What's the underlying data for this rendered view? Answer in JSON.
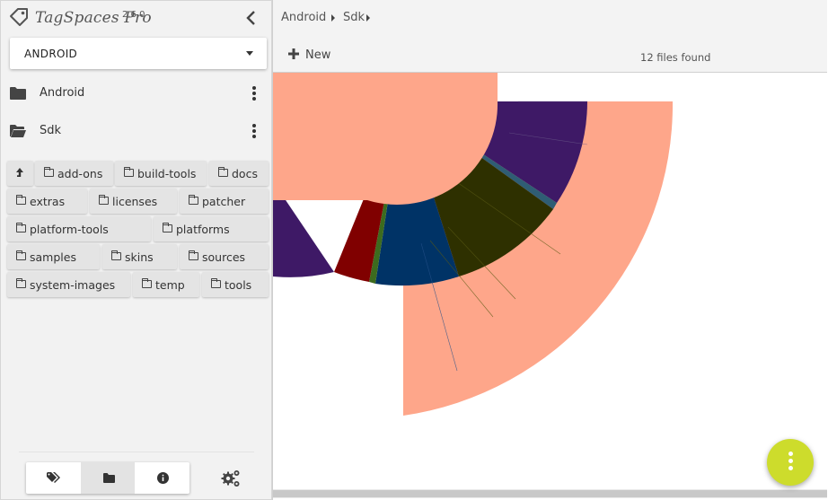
{
  "app": {
    "name": "TagSpaces Pro",
    "version": "2.6.0",
    "logo_icon": "tag-logo-icon",
    "collapse_icon": "chevron-left-icon"
  },
  "location": {
    "selected": "ANDROID"
  },
  "directories": [
    {
      "label": "Android",
      "icon": "folder-icon",
      "menu_icon": "more-vert-icon"
    },
    {
      "label": "Sdk",
      "icon": "folder-open-icon",
      "menu_icon": "more-vert-icon"
    }
  ],
  "subfolders": {
    "up_icon": "arrow-up-icon",
    "items": [
      "add-ons",
      "build-tools",
      "docs",
      "extras",
      "licenses",
      "patcher",
      "platform-tools",
      "platforms",
      "samples",
      "skins",
      "sources",
      "system-images",
      "temp",
      "tools"
    ]
  },
  "bottom_tabs": [
    {
      "icon": "tags-icon",
      "active": false
    },
    {
      "icon": "folder-icon",
      "active": true
    },
    {
      "icon": "info-icon",
      "active": false
    }
  ],
  "settings_icon": "gears-icon",
  "breadcrumb": [
    "Android",
    "Sdk"
  ],
  "toolbar": {
    "new_label": "New",
    "new_icon": "plus-icon",
    "files_found": "12 files found"
  },
  "fab_icon": "more-vert-icon",
  "colors": {
    "outer_ring": "#fea68a",
    "purple": "#3e1966",
    "olive": "#2e3000",
    "navy": "#003366",
    "dark_red": "#800000",
    "fab": "#cddc2c"
  }
}
